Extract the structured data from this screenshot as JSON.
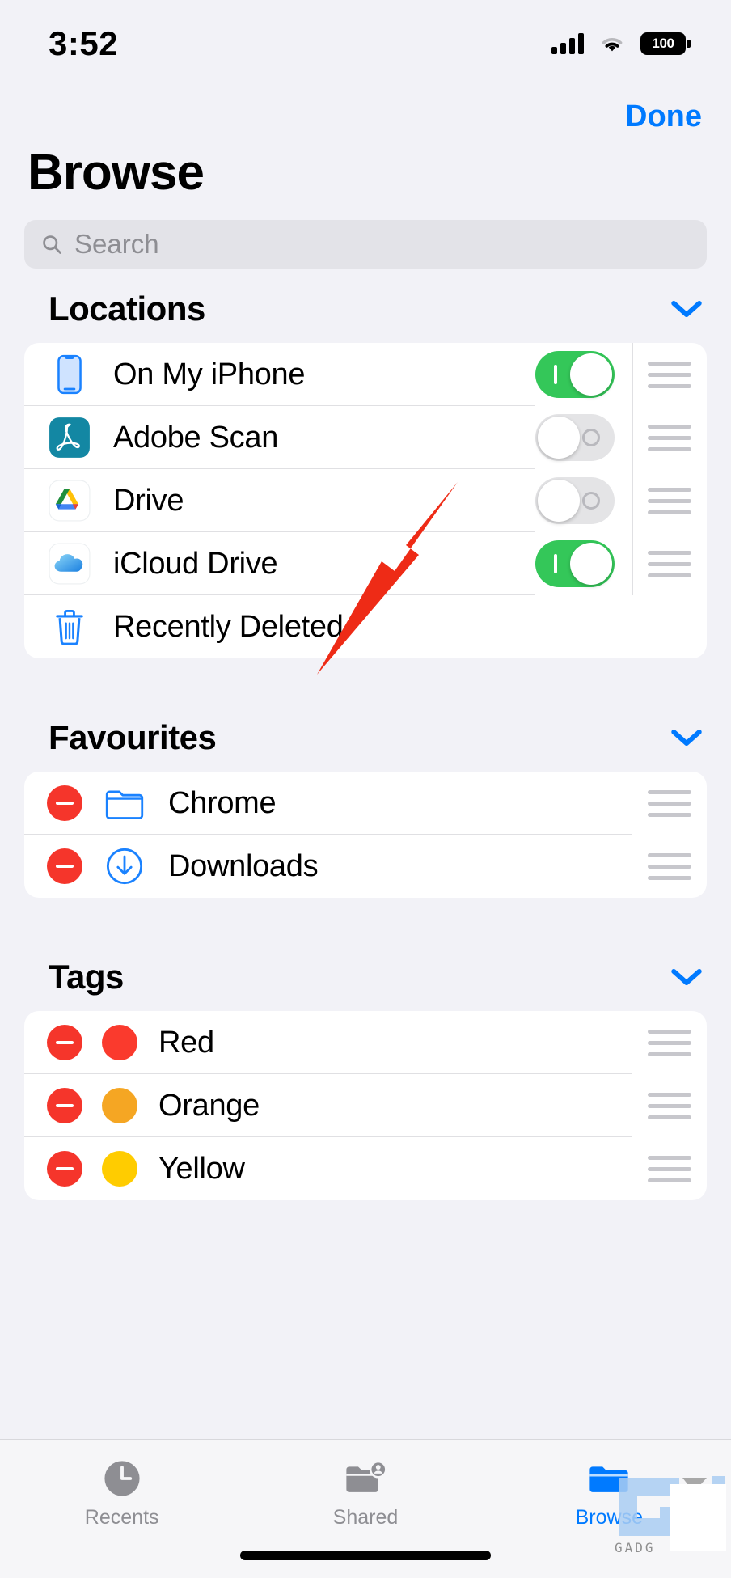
{
  "statusbar": {
    "time": "3:52",
    "battery_percent": "100",
    "signal_icon": "cellular-signal-icon",
    "wifi_icon": "wifi-icon",
    "battery_icon": "battery-icon"
  },
  "navbar": {
    "done_label": "Done"
  },
  "page_title": "Browse",
  "search": {
    "placeholder": "Search",
    "value": "",
    "icon": "search-icon"
  },
  "sections": [
    {
      "title": "Locations",
      "collapse_icon": "chevron-down-icon",
      "rows": [
        {
          "label": "On My iPhone",
          "icon": "iphone-icon",
          "toggle": "on",
          "handle": true
        },
        {
          "label": "Adobe Scan",
          "icon": "adobe-scan-icon",
          "toggle": "off",
          "handle": true
        },
        {
          "label": "Drive",
          "icon": "google-drive-icon",
          "toggle": "off",
          "handle": true
        },
        {
          "label": "iCloud Drive",
          "icon": "icloud-drive-icon",
          "toggle": "on",
          "handle": true
        },
        {
          "label": "Recently Deleted",
          "icon": "trash-icon",
          "toggle": null,
          "handle": false
        }
      ]
    },
    {
      "title": "Favourites",
      "collapse_icon": "chevron-down-icon",
      "rows": [
        {
          "label": "Chrome",
          "icon": "folder-icon",
          "remove": true,
          "handle": true
        },
        {
          "label": "Downloads",
          "icon": "downloads-folder-icon",
          "remove": true,
          "handle": true
        }
      ]
    },
    {
      "title": "Tags",
      "collapse_icon": "chevron-down-icon",
      "rows": [
        {
          "label": "Red",
          "dot_color": "#fa3a2d",
          "remove": true,
          "handle": true
        },
        {
          "label": "Orange",
          "dot_color": "#f5a623",
          "remove": true,
          "handle": true
        },
        {
          "label": "Yellow",
          "dot_color": "#ffcc00",
          "remove": true,
          "handle": true
        }
      ]
    }
  ],
  "tabbar": {
    "tabs": [
      {
        "label": "Recents",
        "icon": "clock-icon",
        "active": false
      },
      {
        "label": "Shared",
        "icon": "shared-folder-icon",
        "active": false
      },
      {
        "label": "Browse",
        "icon": "folder-filled-icon",
        "active": true
      }
    ]
  },
  "annotation": {
    "arrow": "red-arrow-pointing-to-drive-toggle",
    "color": "#ee2b16"
  },
  "watermark": {
    "text": "GADG",
    "logo": "gadgets-logo-icon"
  },
  "colors": {
    "accent_blue": "#007aff",
    "toggle_on_green": "#34c759",
    "remove_red": "#f5352b",
    "page_background": "#f2f2f7",
    "card_background": "#ffffff"
  }
}
